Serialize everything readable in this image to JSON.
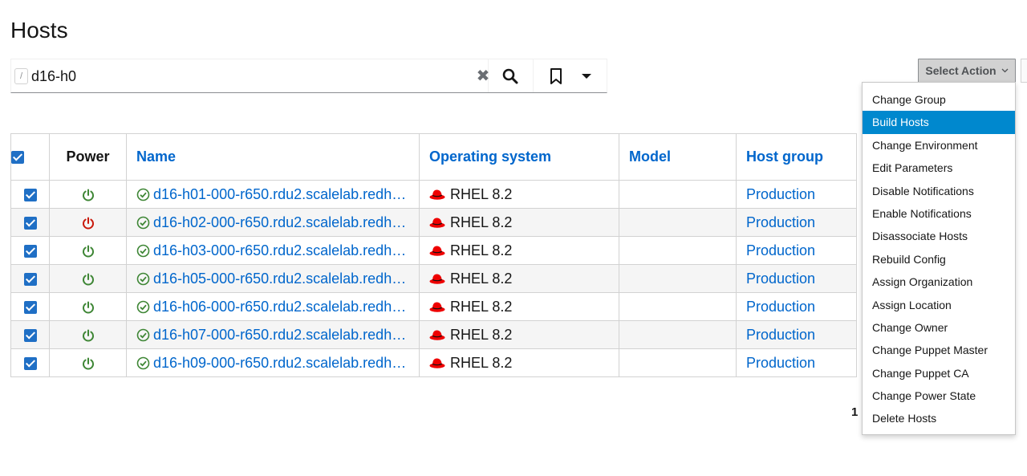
{
  "page": {
    "title": "Hosts"
  },
  "search": {
    "value": "d16-h0",
    "slash_hint": "/"
  },
  "actions": {
    "select_action_label": "Select Action"
  },
  "table": {
    "headers": {
      "power": "Power",
      "name": "Name",
      "os": "Operating system",
      "model": "Model",
      "host_group": "Host group"
    },
    "rows": [
      {
        "power": "on",
        "name": "d16-h01-000-r650.rdu2.scalelab.redhat....",
        "os": "RHEL 8.2",
        "model": "",
        "host_group": "Production"
      },
      {
        "power": "off",
        "name": "d16-h02-000-r650.rdu2.scalelab.redhat...",
        "os": "RHEL 8.2",
        "model": "",
        "host_group": "Production"
      },
      {
        "power": "on",
        "name": "d16-h03-000-r650.rdu2.scalelab.redhat...",
        "os": "RHEL 8.2",
        "model": "",
        "host_group": "Production"
      },
      {
        "power": "on",
        "name": "d16-h05-000-r650.rdu2.scalelab.redhat...",
        "os": "RHEL 8.2",
        "model": "",
        "host_group": "Production"
      },
      {
        "power": "on",
        "name": "d16-h06-000-r650.rdu2.scalelab.redhat...",
        "os": "RHEL 8.2",
        "model": "",
        "host_group": "Production"
      },
      {
        "power": "on",
        "name": "d16-h07-000-r650.rdu2.scalelab.redhat....",
        "os": "RHEL 8.2",
        "model": "",
        "host_group": "Production"
      },
      {
        "power": "on",
        "name": "d16-h09-000-r650.rdu2.scalelab.redhat...",
        "os": "RHEL 8.2",
        "model": "",
        "host_group": "Production"
      }
    ]
  },
  "menu": {
    "items": [
      "Change Group",
      "Build Hosts",
      "Change Environment",
      "Edit Parameters",
      "Disable Notifications",
      "Enable Notifications",
      "Disassociate Hosts",
      "Rebuild Config",
      "Assign Organization",
      "Assign Location",
      "Change Owner",
      "Change Puppet Master",
      "Change Puppet CA",
      "Change Power State",
      "Delete Hosts"
    ],
    "active_index": 1
  },
  "pagination": {
    "page": "1"
  },
  "colors": {
    "link": "#0066cc",
    "power_on": "#3e8635",
    "power_off": "#c9190b",
    "menu_active": "#0088ce",
    "checkbox": "#1f6fc5",
    "redhat": "#ee0000"
  }
}
